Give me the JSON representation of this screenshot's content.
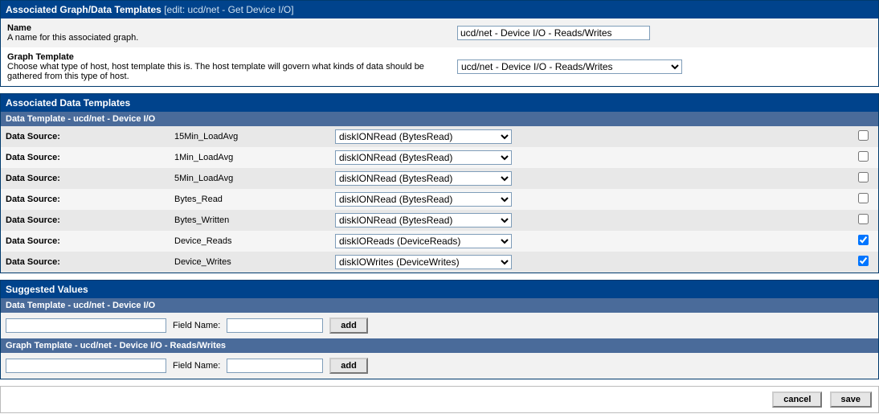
{
  "header": {
    "title": "Associated Graph/Data Templates",
    "edit_prefix": "[edit: ",
    "edit_label": "ucd/net - Get Device I/O",
    "edit_suffix": "]"
  },
  "form": {
    "name": {
      "label": "Name",
      "help": "A name for this associated graph.",
      "value": "ucd/net - Device I/O - Reads/Writes"
    },
    "graph_template": {
      "label": "Graph Template",
      "help": "Choose what type of host, host template this is. The host template will govern what kinds of data should be gathered from this type of host.",
      "selected": "ucd/net - Device I/O - Reads/Writes"
    }
  },
  "assoc": {
    "title": "Associated Data Templates",
    "sub": "Data Template - ucd/net - Device I/O",
    "rows": [
      {
        "label": "Data Source:",
        "name": "15Min_LoadAvg",
        "map": "diskIONRead (BytesRead)",
        "checked": false
      },
      {
        "label": "Data Source:",
        "name": "1Min_LoadAvg",
        "map": "diskIONRead (BytesRead)",
        "checked": false
      },
      {
        "label": "Data Source:",
        "name": "5Min_LoadAvg",
        "map": "diskIONRead (BytesRead)",
        "checked": false
      },
      {
        "label": "Data Source:",
        "name": "Bytes_Read",
        "map": "diskIONRead (BytesRead)",
        "checked": false
      },
      {
        "label": "Data Source:",
        "name": "Bytes_Written",
        "map": "diskIONRead (BytesRead)",
        "checked": false
      },
      {
        "label": "Data Source:",
        "name": "Device_Reads",
        "map": "diskIOReads (DeviceReads)",
        "checked": true
      },
      {
        "label": "Data Source:",
        "name": "Device_Writes",
        "map": "diskIOWrites (DeviceWrites)",
        "checked": true
      }
    ]
  },
  "suggested": {
    "title": "Suggested Values",
    "sub1": "Data Template - ucd/net - Device I/O",
    "sub2": "Graph Template - ucd/net - Device I/O - Reads/Writes",
    "field_name_label": "Field Name:",
    "add_label": "add"
  },
  "buttons": {
    "cancel": "cancel",
    "save": "save"
  }
}
